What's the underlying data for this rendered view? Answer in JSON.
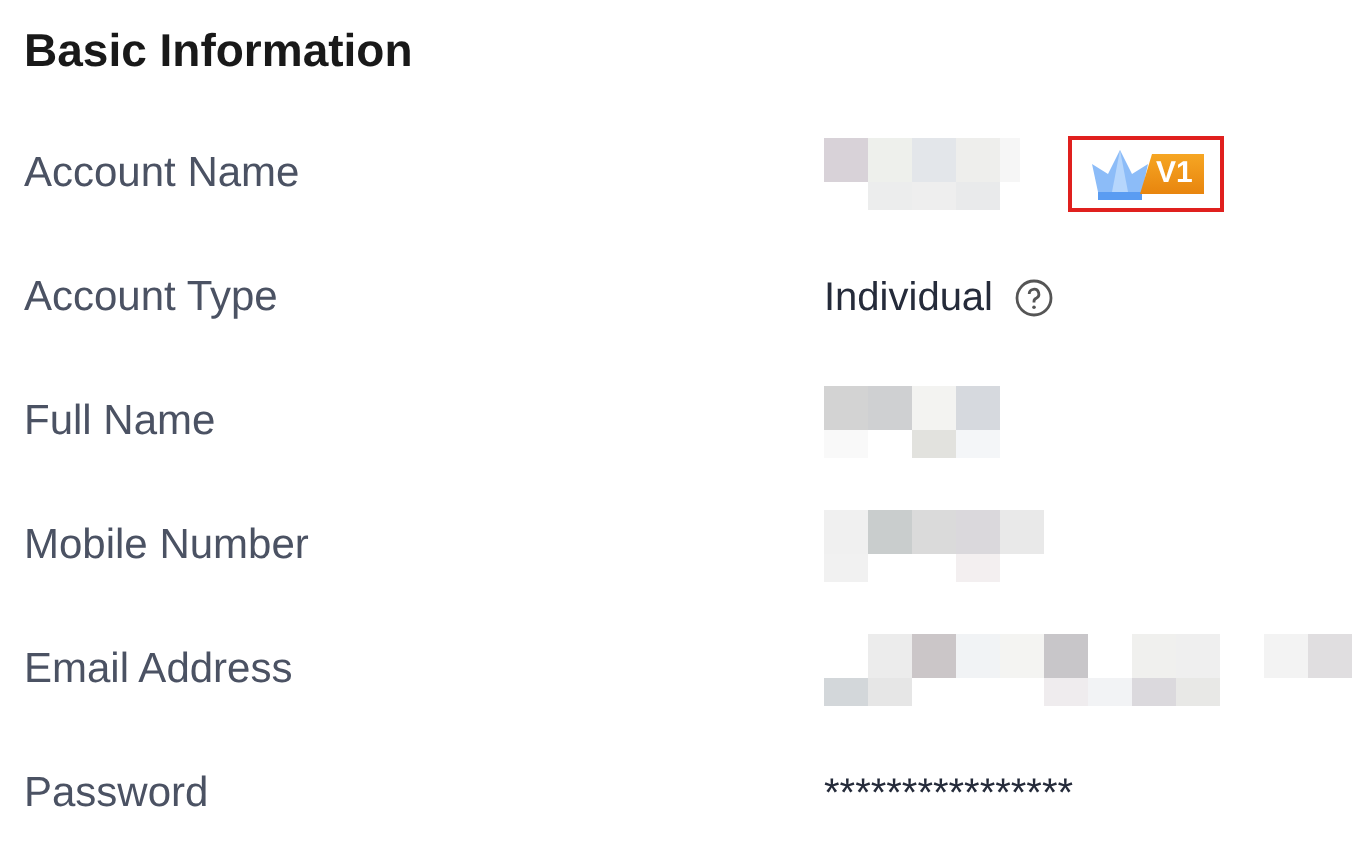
{
  "section_title": "Basic Information",
  "fields": [
    {
      "label": "Account Name",
      "kind": "redacted",
      "badge": {
        "text": "V1",
        "highlighted": true
      }
    },
    {
      "label": "Account Type",
      "kind": "text_help",
      "value": "Individual"
    },
    {
      "label": "Full Name",
      "kind": "redacted"
    },
    {
      "label": "Mobile Number",
      "kind": "redacted"
    },
    {
      "label": "Email Address",
      "kind": "redacted"
    },
    {
      "label": "Password",
      "kind": "text",
      "value": "****************"
    }
  ]
}
